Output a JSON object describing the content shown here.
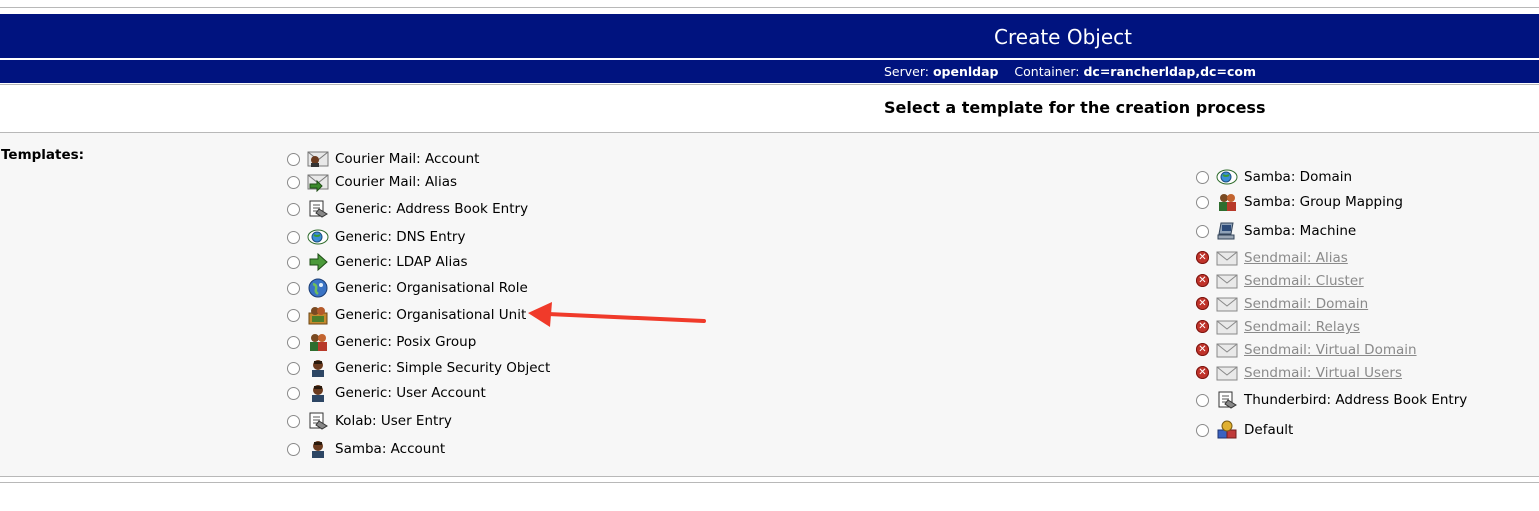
{
  "page": {
    "title": "Create Object",
    "server_label": "Server:",
    "server": "openldap",
    "container_label": "Container:",
    "container": "dc=rancherldap,dc=com",
    "heading": "Select a template for the creation process",
    "templates_label": "Templates:"
  },
  "left_templates": [
    {
      "label": "Courier Mail: Account",
      "icon": "mail-account-icon"
    },
    {
      "label": "Courier Mail: Alias",
      "icon": "mail-alias-icon"
    },
    {
      "label": "Generic: Address Book Entry",
      "icon": "address-book-icon"
    },
    {
      "label": "Generic: DNS Entry",
      "icon": "dns-icon"
    },
    {
      "label": "Generic: LDAP Alias",
      "icon": "arrow-right-icon"
    },
    {
      "label": "Generic: Organisational Role",
      "icon": "globe-icon"
    },
    {
      "label": "Generic: Organisational Unit",
      "icon": "ou-icon"
    },
    {
      "label": "Generic: Posix Group",
      "icon": "group-icon"
    },
    {
      "label": "Generic: Simple Security Object",
      "icon": "user-icon"
    },
    {
      "label": "Generic: User Account",
      "icon": "user-icon"
    },
    {
      "label": "Kolab: User Entry",
      "icon": "address-book-icon"
    },
    {
      "label": "Samba: Account",
      "icon": "user-icon"
    }
  ],
  "right_templates": [
    {
      "label": "Samba: Domain",
      "icon": "dns-icon",
      "disabled": false
    },
    {
      "label": "Samba: Group Mapping",
      "icon": "group-icon",
      "disabled": false
    },
    {
      "label": "Samba: Machine",
      "icon": "computer-icon",
      "disabled": false
    },
    {
      "label": "Sendmail: Alias",
      "icon": "envelope-icon",
      "disabled": true
    },
    {
      "label": "Sendmail: Cluster",
      "icon": "envelope-icon",
      "disabled": true
    },
    {
      "label": "Sendmail: Domain",
      "icon": "envelope-icon",
      "disabled": true
    },
    {
      "label": "Sendmail: Relays",
      "icon": "envelope-icon",
      "disabled": true
    },
    {
      "label": "Sendmail: Virtual Domain",
      "icon": "envelope-icon",
      "disabled": true
    },
    {
      "label": "Sendmail: Virtual Users",
      "icon": "envelope-icon",
      "disabled": true
    },
    {
      "label": "Thunderbird: Address Book Entry",
      "icon": "address-book-icon",
      "disabled": false
    },
    {
      "label": "Default",
      "icon": "objects-icon",
      "disabled": false
    }
  ],
  "colors": {
    "title_bar": "#00137f",
    "panel": "#f7f7f7",
    "annotation_arrow": "#f03a2a",
    "disabled_text": "#8a8a8a"
  }
}
